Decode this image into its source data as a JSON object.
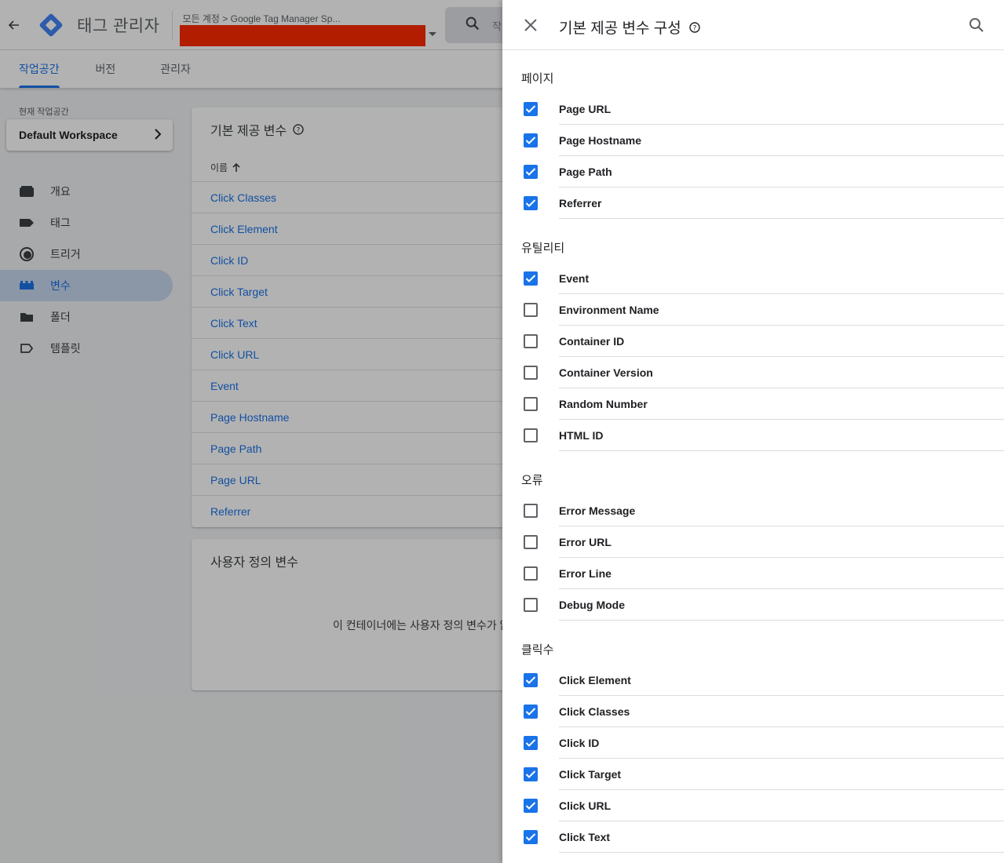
{
  "app": {
    "title": "태그 관리자",
    "breadcrumb": "모든 계정 > Google Tag Manager Sp...",
    "search_hint": "작"
  },
  "tabs": [
    {
      "label": "작업공간"
    },
    {
      "label": "버전"
    },
    {
      "label": "관리자"
    }
  ],
  "sidebar": {
    "workspace_label": "현재 작업공간",
    "workspace_name": "Default Workspace",
    "items": [
      {
        "label": "개요",
        "icon": "overview-icon"
      },
      {
        "label": "태그",
        "icon": "tag-icon"
      },
      {
        "label": "트리거",
        "icon": "trigger-icon"
      },
      {
        "label": "변수",
        "icon": "variables-icon"
      },
      {
        "label": "폴더",
        "icon": "folder-icon"
      },
      {
        "label": "템플릿",
        "icon": "template-icon"
      }
    ]
  },
  "builtin_card": {
    "title": "기본 제공 변수",
    "column_name": "이름",
    "rows": [
      "Click Classes",
      "Click Element",
      "Click ID",
      "Click Target",
      "Click Text",
      "Click URL",
      "Event",
      "Page Hostname",
      "Page Path",
      "Page URL",
      "Referrer"
    ]
  },
  "custom_card": {
    "title": "사용자 정의 변수",
    "empty_message": "이 컨테이너에는 사용자 정의 변수가 없"
  },
  "panel": {
    "title": "기본 제공 변수 구성",
    "sections": [
      {
        "title": "페이지",
        "options": [
          {
            "label": "Page URL",
            "checked": true
          },
          {
            "label": "Page Hostname",
            "checked": true
          },
          {
            "label": "Page Path",
            "checked": true
          },
          {
            "label": "Referrer",
            "checked": true
          }
        ]
      },
      {
        "title": "유틸리티",
        "options": [
          {
            "label": "Event",
            "checked": true
          },
          {
            "label": "Environment Name",
            "checked": false
          },
          {
            "label": "Container ID",
            "checked": false
          },
          {
            "label": "Container Version",
            "checked": false
          },
          {
            "label": "Random Number",
            "checked": false
          },
          {
            "label": "HTML ID",
            "checked": false
          }
        ]
      },
      {
        "title": "오류",
        "options": [
          {
            "label": "Error Message",
            "checked": false
          },
          {
            "label": "Error URL",
            "checked": false
          },
          {
            "label": "Error Line",
            "checked": false
          },
          {
            "label": "Debug Mode",
            "checked": false
          }
        ]
      },
      {
        "title": "클릭수",
        "options": [
          {
            "label": "Click Element",
            "checked": true
          },
          {
            "label": "Click Classes",
            "checked": true
          },
          {
            "label": "Click ID",
            "checked": true
          },
          {
            "label": "Click Target",
            "checked": true
          },
          {
            "label": "Click URL",
            "checked": true
          },
          {
            "label": "Click Text",
            "checked": true
          }
        ]
      }
    ]
  },
  "colors": {
    "accent": "#1a73e8",
    "redaction": "#ff2a00",
    "brand": "#4285f4"
  }
}
